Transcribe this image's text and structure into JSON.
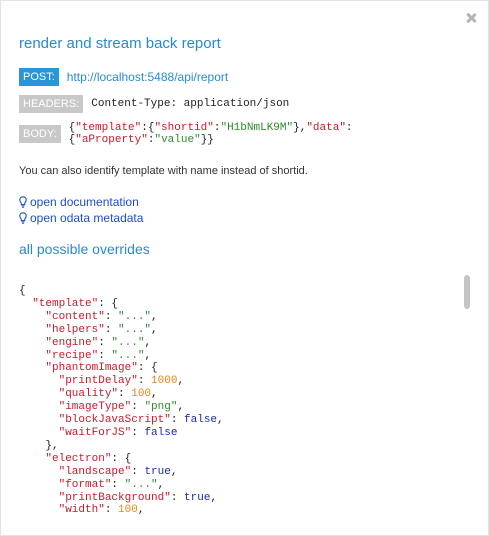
{
  "title": "render and stream back report",
  "request": {
    "post_label": "POST:",
    "url": "http://localhost:5488/api/report",
    "headers_label": "HEADERS:",
    "headers_value": "Content-Type: application/json",
    "body_label": "BODY:",
    "body_value": "{\"template\":{\"shortid\":\"H1bNmLK9M\"},\"data\":{\"aProperty\":\"value\"}}"
  },
  "note": "You can also identify template with name instead of shortid.",
  "links": {
    "documentation": "open documentation",
    "odata": "open odata metadata"
  },
  "overrides_title": "all possible overrides",
  "code_lines": [
    "{",
    "  \"template\": {",
    "    \"content\": \"...\",",
    "    \"helpers\": \"...\",",
    "    \"engine\": \"...\",",
    "    \"recipe\": \"...\",",
    "    \"phantomImage\": {",
    "      \"printDelay\": 1000,",
    "      \"quality\": 100,",
    "      \"imageType\": \"png\",",
    "      \"blockJavaScript\": false,",
    "      \"waitForJS\": false",
    "    },",
    "    \"electron\": {",
    "      \"landscape\": true,",
    "      \"format\": \"...\",",
    "      \"printBackground\": true,",
    "      \"width\": 100,"
  ],
  "colors": {
    "accent": "#2a8bc9",
    "post_badge": "#2a96d6",
    "grey_badge": "#c8c8c8",
    "json_key": "#c21d2b",
    "json_string": "#2f8a2f",
    "json_number": "#e08a1a",
    "json_boolean": "#1b2da6"
  },
  "icons": {
    "close": "close-icon",
    "bulb": "lightbulb-icon"
  }
}
